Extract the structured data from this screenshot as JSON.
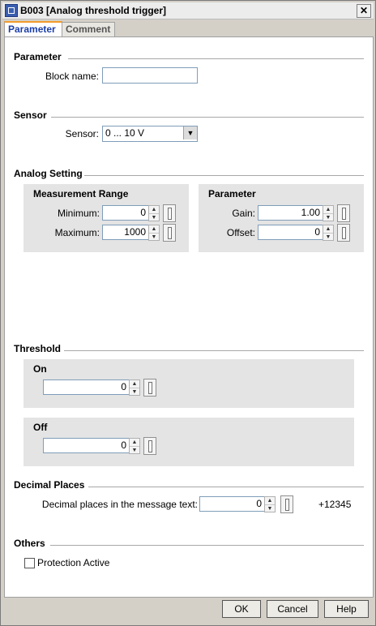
{
  "window": {
    "title": "B003 [Analog threshold trigger]",
    "close_glyph": "✕"
  },
  "tabs": [
    {
      "label": "Parameter"
    },
    {
      "label": "Comment"
    }
  ],
  "parameter_section": {
    "heading": "Parameter",
    "block_name_label": "Block name:",
    "block_name_value": ""
  },
  "sensor_section": {
    "heading": "Sensor",
    "sensor_label": "Sensor:",
    "sensor_value": "0 ... 10 V"
  },
  "analog_setting": {
    "heading": "Analog Setting",
    "measurement_range": {
      "heading": "Measurement Range",
      "min_label": "Minimum:",
      "min_value": "0",
      "max_label": "Maximum:",
      "max_value": "1000"
    },
    "parameter": {
      "heading": "Parameter",
      "gain_label": "Gain:",
      "gain_value": "1.00",
      "offset_label": "Offset:",
      "offset_value": "0"
    }
  },
  "threshold": {
    "heading": "Threshold",
    "on": {
      "heading": "On",
      "value": "0"
    },
    "off": {
      "heading": "Off",
      "value": "0"
    }
  },
  "decimal_places": {
    "heading": "Decimal Places",
    "label": "Decimal places in the message text:",
    "value": "0",
    "preview": "+12345"
  },
  "others": {
    "heading": "Others",
    "protection_label": "Protection Active",
    "protection_checked": false
  },
  "buttons": {
    "ok": "OK",
    "cancel": "Cancel",
    "help": "Help"
  }
}
